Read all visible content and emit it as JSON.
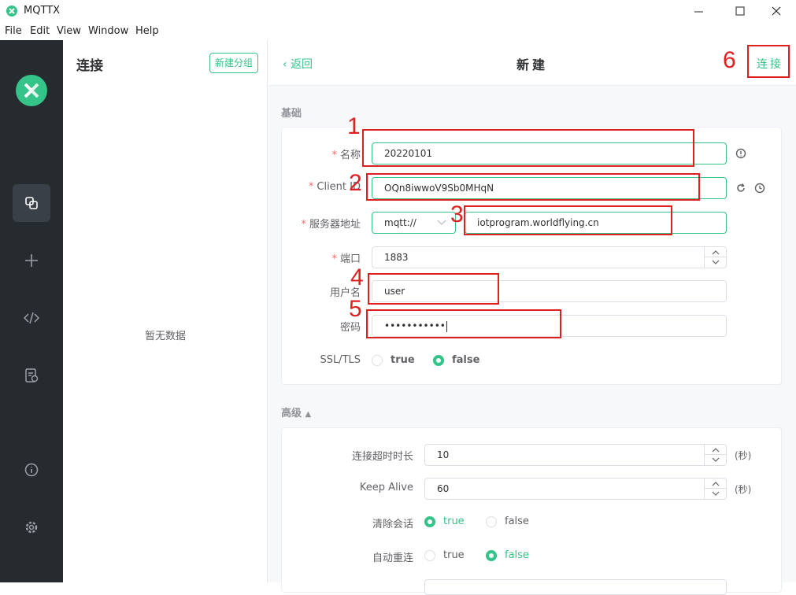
{
  "app": {
    "title": "MQTTX"
  },
  "menu": [
    "File",
    "Edit",
    "View",
    "Window",
    "Help"
  ],
  "nav": {
    "items": [
      "connections-icon",
      "plus-icon",
      "code-icon",
      "log-icon",
      "info-icon",
      "gear-icon"
    ]
  },
  "connections": {
    "title": "连接",
    "new_group": "新建分组",
    "empty": "暂无数据"
  },
  "header": {
    "back": "返回",
    "title": "新建",
    "connect": "连接"
  },
  "basic": {
    "label": "基础",
    "name_label": "名称",
    "name_value": "20220101",
    "client_id_label": "Client ID",
    "client_id_value": "OQn8iwwoV9Sb0MHqN",
    "host_label": "服务器地址",
    "protocol_value": "mqtt://",
    "host_value": "iotprogram.worldflying.cn",
    "port_label": "端口",
    "port_value": "1883",
    "username_label": "用户名",
    "username_value": "user",
    "password_label": "密码",
    "password_value": "•••••••••••",
    "ssl_label": "SSL/TLS",
    "ssl_true": "true",
    "ssl_false": "false"
  },
  "advanced": {
    "label": "高级",
    "timeout_label": "连接超时时长",
    "timeout_value": "10",
    "timeout_unit": "(秒)",
    "keepalive_label": "Keep Alive",
    "keepalive_value": "60",
    "keepalive_unit": "(秒)",
    "clean_label": "清除会话",
    "clean_true": "true",
    "clean_false": "false",
    "reconnect_label": "自动重连",
    "reconnect_true": "true",
    "reconnect_false": "false"
  },
  "annotations": [
    "1",
    "2",
    "3",
    "4",
    "5",
    "6"
  ],
  "colors": {
    "accent": "#34c388",
    "nav_bg": "#262b30",
    "annotation": "#e02020"
  }
}
